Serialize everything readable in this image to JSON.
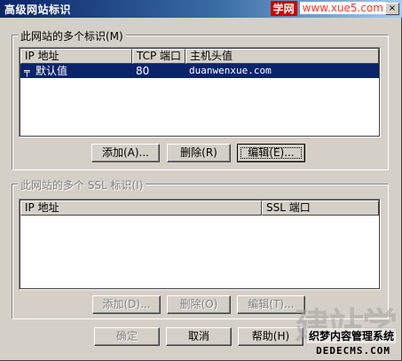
{
  "window": {
    "title": "高级网站标识",
    "close_glyph": "×"
  },
  "watermark_top": {
    "badge": "学网",
    "site": "www.xue5.com"
  },
  "identities_group": {
    "label": "此网站的多个标识(M)",
    "columns": [
      "IP 地址",
      "TCP 端口",
      "主机头值"
    ],
    "rows": [
      {
        "ip": "默认值",
        "port": "80",
        "host": "duanwenxue.com",
        "selected": true
      }
    ],
    "buttons": {
      "add": "添加(A)...",
      "remove": "删除(R)",
      "edit": "编辑(E)..."
    }
  },
  "ssl_group": {
    "label": "此网站的多个 SSL 标识(I)",
    "columns": [
      "IP 地址",
      "SSL 端口"
    ],
    "buttons": {
      "add": "添加(D)...",
      "remove": "删除(O)",
      "edit": "编辑(T)..."
    }
  },
  "footer": {
    "ok": "确定",
    "cancel": "取消",
    "help": "帮助(H)"
  },
  "watermark_bottom": {
    "big": "建站学",
    "cn": "织梦内容管理系统",
    "url": "DEDECMS.COM"
  }
}
